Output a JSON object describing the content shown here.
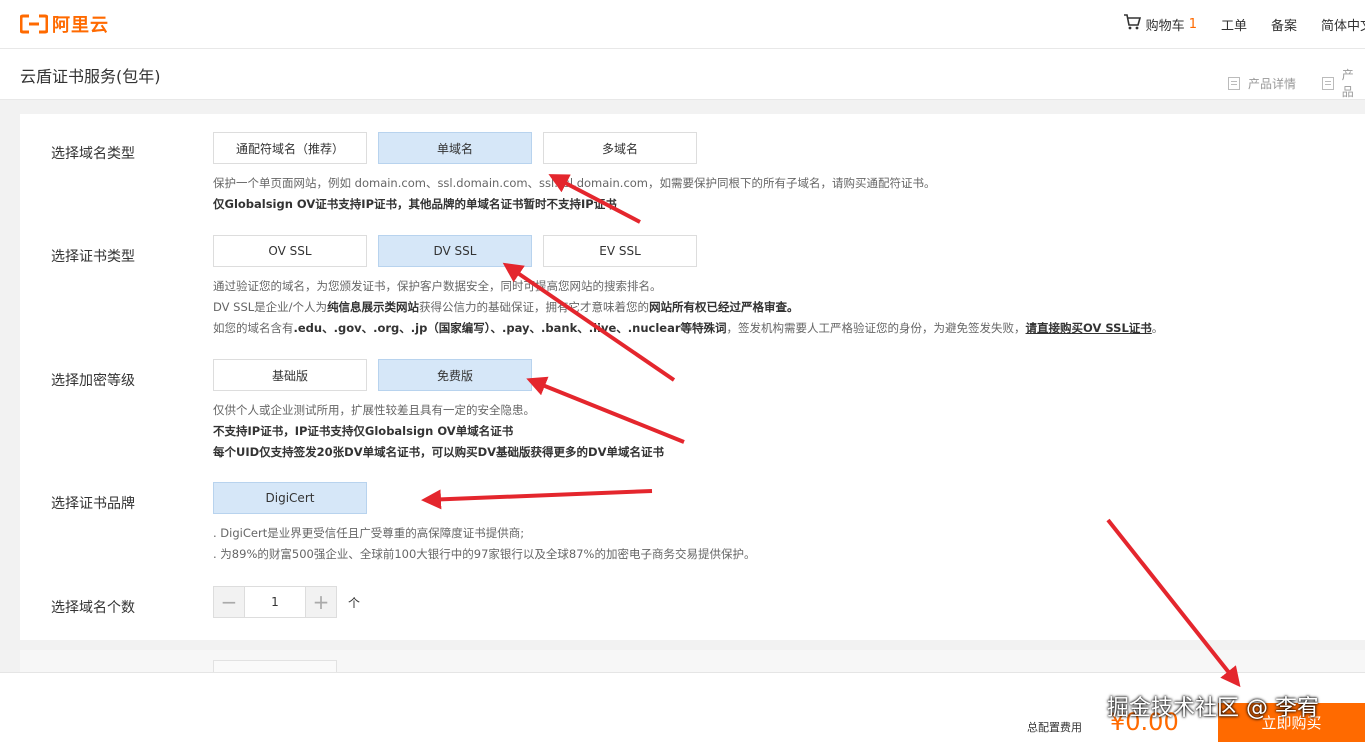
{
  "header": {
    "logo_text": "阿里云",
    "cart_label": "购物车",
    "cart_count": "1",
    "ticket_label": "工单",
    "icp_label": "备案",
    "lang_label": "简体中文"
  },
  "subheader": {
    "title": "云盾证书服务(包年)",
    "link_details": "产品详情",
    "link_other": "产品"
  },
  "domain_type": {
    "label": "选择域名类型",
    "options": [
      "通配符域名（推荐）",
      "单域名",
      "多域名"
    ],
    "selected": "单域名",
    "desc_line1": "保护一个单页面网站，例如 domain.com、ssl.domain.com、ssl.ssl.domain.com，如需要保护同根下的所有子域名，请购买通配符证书。",
    "desc_line2": "仅Globalsign OV证书支持IP证书，其他品牌的单域名证书暂时不支持IP证书"
  },
  "cert_type": {
    "label": "选择证书类型",
    "options": [
      "OV SSL",
      "DV SSL",
      "EV SSL"
    ],
    "selected": "DV SSL",
    "desc_line1": "通过验证您的域名，为您颁发证书，保护客户数据安全，同时可提高您网站的搜索排名。",
    "desc_line2_a": "DV SSL是企业/个人为",
    "desc_line2_b": "纯信息展示类网站",
    "desc_line2_c": "获得公信力的基础保证，拥有它才意味着您的",
    "desc_line2_d": "网站所有权已经过严格审查。",
    "desc_line3_a": "如您的域名含有",
    "desc_line3_b": ".edu、.gov、.org、.jp（国家编写）、.pay、.bank、.live、.nuclear等特殊词",
    "desc_line3_c": "，签发机构需要人工严格验证您的身份，为避免签发失败，",
    "desc_line3_link": "请直接购买OV SSL证书",
    "desc_line3_end": "。"
  },
  "encryption": {
    "label": "选择加密等级",
    "options": [
      "基础版",
      "免费版"
    ],
    "selected": "免费版",
    "desc_line1": "仅供个人或企业测试所用，扩展性较差且具有一定的安全隐患。",
    "desc_line2": "不支持IP证书，IP证书支持仅Globalsign OV单域名证书",
    "desc_line3": "每个UID仅支持签发20张DV单域名证书，可以购买DV基础版获得更多的DV单域名证书"
  },
  "brand": {
    "label": "选择证书品牌",
    "options": [
      "DigiCert"
    ],
    "selected": "DigiCert",
    "desc_line1": ". DigiCert是业界更受信任且广受尊重的高保障度证书提供商;",
    "desc_line2": ". 为89%的财富500强企业、全球前100大银行中的97家银行以及全球87%的加密电子商务交易提供保护。"
  },
  "domain_count": {
    "label": "选择域名个数",
    "minus": "−",
    "plus": "+",
    "value": "1",
    "unit": "个"
  },
  "footer": {
    "total_label": "总配置费用",
    "price": "¥0.00",
    "buy_label": "立即购买",
    "watermark": "掘金技术社区 @ 李宥"
  },
  "colors": {
    "brand": "#ff6a00",
    "selected_bg": "#d6e7f8",
    "arrow": "#e4262d"
  }
}
